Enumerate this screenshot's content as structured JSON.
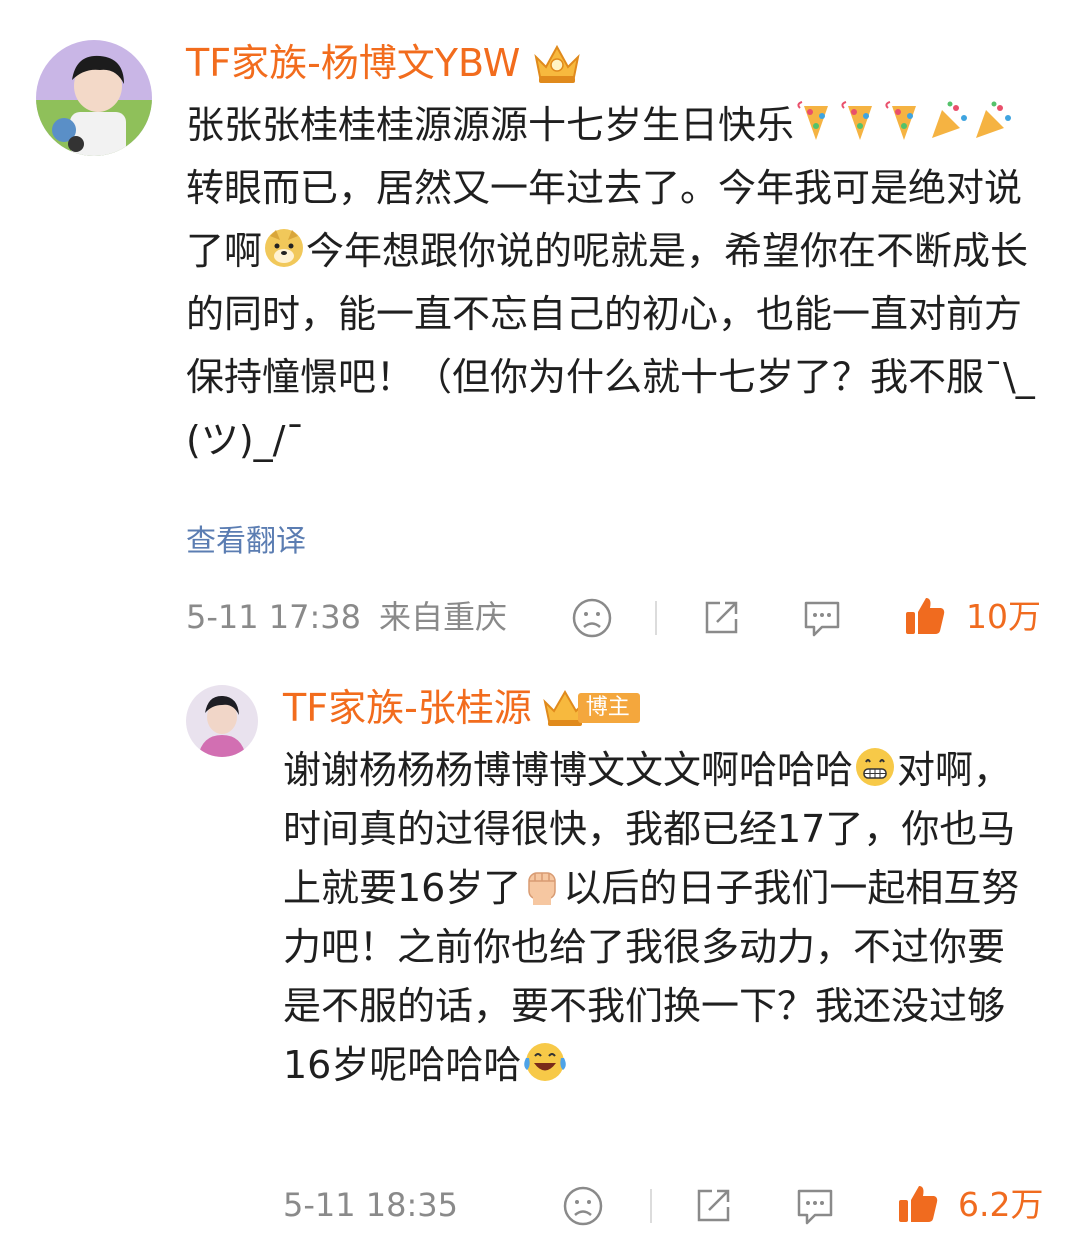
{
  "comment": {
    "username": "TF家族-杨博文YBW",
    "text_parts": [
      "张张张桂桂桂源源源十七岁生日快乐",
      "转眼而已，居然又一年过去了。今年我可是绝对说了啊",
      "今年想跟你说的呢就是，希望你在不断成长的同时，能一直不忘自己的初心，也能一直对前方保持憧憬吧！（但你为什么就十七岁了？我不服¯\\_(ツ)_/¯"
    ],
    "translate_label": "查看翻译",
    "time": "5-11 17:38",
    "location": "来自重庆",
    "likes": "10万"
  },
  "reply": {
    "username": "TF家族-张桂源",
    "badge": "博主",
    "text_parts": [
      "谢谢杨杨杨博博博文文文啊哈哈哈",
      "对啊，时间真的过得很快，我都已经17了，你也马上就要16岁了",
      "以后的日子我们一起相互努力吧！之前你也给了我很多动力，不过你要是不服的话，要不我们换一下？我还没过够16岁呢哈哈哈"
    ],
    "time": "5-11 18:35",
    "likes": "6.2万"
  },
  "colors": {
    "username": "#f26c1d",
    "body_text": "#1f1f1f",
    "meta": "#8a8a8a",
    "translate_link": "#5b7db2",
    "like_accent": "#f06b1f",
    "badge": "#f4a73d"
  },
  "icons": [
    "crown-icon",
    "party-popper-icon",
    "doge-icon",
    "fist-icon",
    "grin-icon",
    "laugh-cry-icon",
    "dislike-face-icon",
    "share-icon",
    "comment-icon",
    "thumbs-up-icon"
  ]
}
